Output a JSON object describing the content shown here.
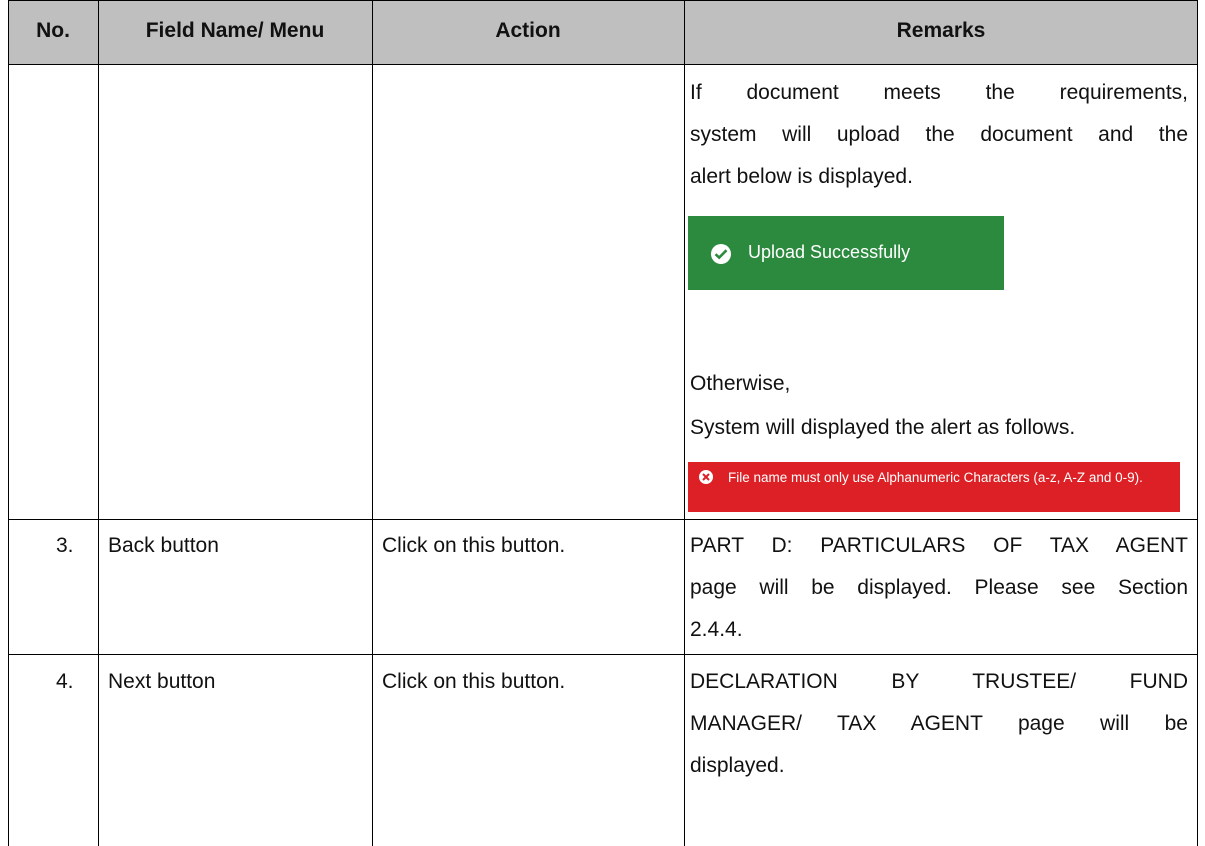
{
  "headers": {
    "no": "No.",
    "field": "Field Name/ Menu",
    "action": "Action",
    "remarks": "Remarks"
  },
  "row_continued": {
    "remark_line1": "If document meets the requirements,",
    "remark_line2": "system will upload the document and the",
    "remark_line3": "alert below is displayed.",
    "success_alert": "Upload Successfully",
    "otherwise": "Otherwise,",
    "error_intro": "System will displayed the alert as follows.",
    "error_alert": "File name must only use Alphanumeric Characters (a-z, A-Z and 0-9)."
  },
  "row3": {
    "no": "3.",
    "field": "Back button",
    "action": "Click on this button.",
    "remark_line1": "PART D: PARTICULARS OF TAX AGENT",
    "remark_line2": "page will be displayed. Please see Section",
    "remark_line3": "2.4.4."
  },
  "row4": {
    "no": "4.",
    "field": "Next button",
    "action": "Click on this button.",
    "remark_line1": "DECLARATION BY TRUSTEE/ FUND",
    "remark_line2": "MANAGER/ TAX AGENT page will be",
    "remark_line3": "displayed."
  },
  "colors": {
    "header_bg": "#bfbfbf",
    "success": "#2b8a3e",
    "error": "#dd2025"
  },
  "icons": [
    "check-circle-icon",
    "x-circle-icon"
  ]
}
